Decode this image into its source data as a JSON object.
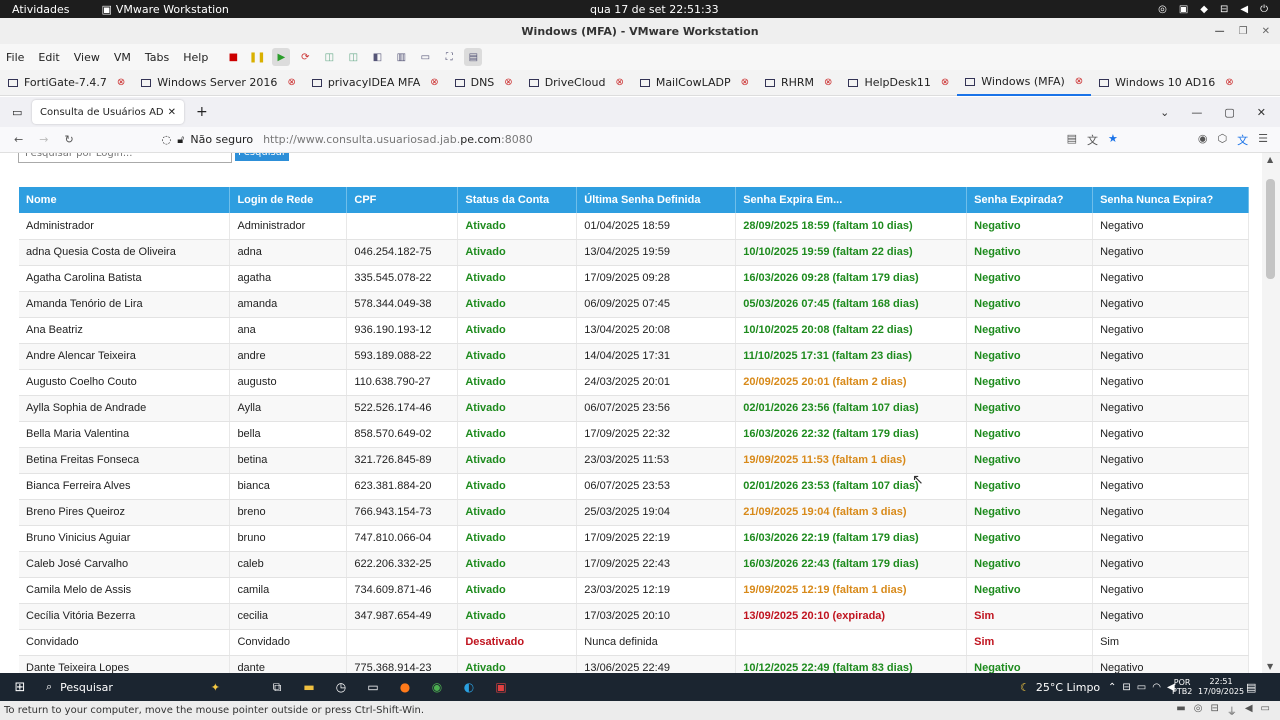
{
  "gnome": {
    "activities": "Atividades",
    "app_name": "VMware Workstation",
    "clock": "qua 17 de set  22:51:33"
  },
  "vmware": {
    "title": "Windows (MFA) - VMware Workstation",
    "menu": [
      "File",
      "Edit",
      "View",
      "VM",
      "Tabs",
      "Help"
    ],
    "tabs": [
      {
        "label": "FortiGate-7.4.7",
        "active": false
      },
      {
        "label": "Windows Server 2016",
        "active": false
      },
      {
        "label": "privacyIDEA MFA",
        "active": false
      },
      {
        "label": "DNS",
        "active": false
      },
      {
        "label": "DriveCloud",
        "active": false
      },
      {
        "label": "MailCowLADP",
        "active": false
      },
      {
        "label": "RHRM",
        "active": false
      },
      {
        "label": "HelpDesk11",
        "active": false
      },
      {
        "label": "Windows (MFA)",
        "active": true
      },
      {
        "label": "Windows 10 AD16",
        "active": false
      }
    ],
    "status_text": "To return to your computer, move the mouse pointer outside or press Ctrl-Shift-Win."
  },
  "browser": {
    "tab_title": "Consulta de Usuários AD",
    "security_label": "Não seguro",
    "url_prefix": "http://www.consulta.usuariosad.jab.",
    "url_domain": "pe.com",
    "url_suffix": ":8080"
  },
  "page": {
    "search_placeholder": "Pesquisar por Login...",
    "search_button": "Pesquisar",
    "columns": [
      "Nome",
      "Login de Rede",
      "CPF",
      "Status da Conta",
      "Última Senha Definida",
      "Senha Expira Em...",
      "Senha Expirada?",
      "Senha Nunca Expira?"
    ],
    "rows": [
      {
        "nome": "Administrador",
        "login": "Administrador",
        "cpf": "",
        "status": "Ativado",
        "status_color": "#1e8b1e",
        "ultima": "01/04/2025 18:59",
        "expira": "28/09/2025 18:59 (faltam 10 dias)",
        "expira_color": "#1e8b1e",
        "expirada": "Negativo",
        "expirada_color": "#1e8b1e",
        "nunca": "Negativo"
      },
      {
        "nome": "adna Quesia Costa de Oliveira",
        "login": "adna",
        "cpf": "046.254.182-75",
        "status": "Ativado",
        "status_color": "#1e8b1e",
        "ultima": "13/04/2025 19:59",
        "expira": "10/10/2025 19:59 (faltam 22 dias)",
        "expira_color": "#1e8b1e",
        "expirada": "Negativo",
        "expirada_color": "#1e8b1e",
        "nunca": "Negativo"
      },
      {
        "nome": "Agatha Carolina Batista",
        "login": "agatha",
        "cpf": "335.545.078-22",
        "status": "Ativado",
        "status_color": "#1e8b1e",
        "ultima": "17/09/2025 09:28",
        "expira": "16/03/2026 09:28 (faltam 179 dias)",
        "expira_color": "#1e8b1e",
        "expirada": "Negativo",
        "expirada_color": "#1e8b1e",
        "nunca": "Negativo"
      },
      {
        "nome": "Amanda Tenório de Lira",
        "login": "amanda",
        "cpf": "578.344.049-38",
        "status": "Ativado",
        "status_color": "#1e8b1e",
        "ultima": "06/09/2025 07:45",
        "expira": "05/03/2026 07:45 (faltam 168 dias)",
        "expira_color": "#1e8b1e",
        "expirada": "Negativo",
        "expirada_color": "#1e8b1e",
        "nunca": "Negativo"
      },
      {
        "nome": "Ana Beatriz",
        "login": "ana",
        "cpf": "936.190.193-12",
        "status": "Ativado",
        "status_color": "#1e8b1e",
        "ultima": "13/04/2025 20:08",
        "expira": "10/10/2025 20:08 (faltam 22 dias)",
        "expira_color": "#1e8b1e",
        "expirada": "Negativo",
        "expirada_color": "#1e8b1e",
        "nunca": "Negativo"
      },
      {
        "nome": "Andre Alencar Teixeira",
        "login": "andre",
        "cpf": "593.189.088-22",
        "status": "Ativado",
        "status_color": "#1e8b1e",
        "ultima": "14/04/2025 17:31",
        "expira": "11/10/2025 17:31 (faltam 23 dias)",
        "expira_color": "#1e8b1e",
        "expirada": "Negativo",
        "expirada_color": "#1e8b1e",
        "nunca": "Negativo"
      },
      {
        "nome": "Augusto Coelho Couto",
        "login": "augusto",
        "cpf": "110.638.790-27",
        "status": "Ativado",
        "status_color": "#1e8b1e",
        "ultima": "24/03/2025 20:01",
        "expira": "20/09/2025 20:01 (faltam 2 dias)",
        "expira_color": "#d88a1a",
        "expirada": "Negativo",
        "expirada_color": "#1e8b1e",
        "nunca": "Negativo"
      },
      {
        "nome": "Aylla Sophia de Andrade",
        "login": "Aylla",
        "cpf": "522.526.174-46",
        "status": "Ativado",
        "status_color": "#1e8b1e",
        "ultima": "06/07/2025 23:56",
        "expira": "02/01/2026 23:56 (faltam 107 dias)",
        "expira_color": "#1e8b1e",
        "expirada": "Negativo",
        "expirada_color": "#1e8b1e",
        "nunca": "Negativo"
      },
      {
        "nome": "Bella Maria Valentina",
        "login": "bella",
        "cpf": "858.570.649-02",
        "status": "Ativado",
        "status_color": "#1e8b1e",
        "ultima": "17/09/2025 22:32",
        "expira": "16/03/2026 22:32 (faltam 179 dias)",
        "expira_color": "#1e8b1e",
        "expirada": "Negativo",
        "expirada_color": "#1e8b1e",
        "nunca": "Negativo"
      },
      {
        "nome": "Betina Freitas Fonseca",
        "login": "betina",
        "cpf": "321.726.845-89",
        "status": "Ativado",
        "status_color": "#1e8b1e",
        "ultima": "23/03/2025 11:53",
        "expira": "19/09/2025 11:53 (faltam 1 dias)",
        "expira_color": "#d88a1a",
        "expirada": "Negativo",
        "expirada_color": "#1e8b1e",
        "nunca": "Negativo"
      },
      {
        "nome": "Bianca Ferreira Alves",
        "login": "bianca",
        "cpf": "623.381.884-20",
        "status": "Ativado",
        "status_color": "#1e8b1e",
        "ultima": "06/07/2025 23:53",
        "expira": "02/01/2026 23:53 (faltam 107 dias)",
        "expira_color": "#1e8b1e",
        "expirada": "Negativo",
        "expirada_color": "#1e8b1e",
        "nunca": "Negativo"
      },
      {
        "nome": "Breno Pires Queiroz",
        "login": "breno",
        "cpf": "766.943.154-73",
        "status": "Ativado",
        "status_color": "#1e8b1e",
        "ultima": "25/03/2025 19:04",
        "expira": "21/09/2025 19:04 (faltam 3 dias)",
        "expira_color": "#d88a1a",
        "expirada": "Negativo",
        "expirada_color": "#1e8b1e",
        "nunca": "Negativo"
      },
      {
        "nome": "Bruno Vinicius Aguiar",
        "login": "bruno",
        "cpf": "747.810.066-04",
        "status": "Ativado",
        "status_color": "#1e8b1e",
        "ultima": "17/09/2025 22:19",
        "expira": "16/03/2026 22:19 (faltam 179 dias)",
        "expira_color": "#1e8b1e",
        "expirada": "Negativo",
        "expirada_color": "#1e8b1e",
        "nunca": "Negativo"
      },
      {
        "nome": "Caleb José Carvalho",
        "login": "caleb",
        "cpf": "622.206.332-25",
        "status": "Ativado",
        "status_color": "#1e8b1e",
        "ultima": "17/09/2025 22:43",
        "expira": "16/03/2026 22:43 (faltam 179 dias)",
        "expira_color": "#1e8b1e",
        "expirada": "Negativo",
        "expirada_color": "#1e8b1e",
        "nunca": "Negativo"
      },
      {
        "nome": "Camila Melo de Assis",
        "login": "camila",
        "cpf": "734.609.871-46",
        "status": "Ativado",
        "status_color": "#1e8b1e",
        "ultima": "23/03/2025 12:19",
        "expira": "19/09/2025 12:19 (faltam 1 dias)",
        "expira_color": "#d88a1a",
        "expirada": "Negativo",
        "expirada_color": "#1e8b1e",
        "nunca": "Negativo"
      },
      {
        "nome": "Cecília Vitória Bezerra",
        "login": "cecilia",
        "cpf": "347.987.654-49",
        "status": "Ativado",
        "status_color": "#1e8b1e",
        "ultima": "17/03/2025 20:10",
        "expira": "13/09/2025 20:10 (expirada)",
        "expira_color": "#c0141f",
        "expirada": "Sim",
        "expirada_color": "#c0141f",
        "nunca": "Negativo"
      },
      {
        "nome": "Convidado",
        "login": "Convidado",
        "cpf": "",
        "status": "Desativado",
        "status_color": "#c0141f",
        "ultima": "Nunca definida",
        "expira": "",
        "expira_color": "#1e8b1e",
        "expirada": "Sim",
        "expirada_color": "#c0141f",
        "nunca": "Sim"
      },
      {
        "nome": "Dante Teixeira Lopes",
        "login": "dante",
        "cpf": "775.368.914-23",
        "status": "Ativado",
        "status_color": "#1e8b1e",
        "ultima": "13/06/2025 22:49",
        "expira": "10/12/2025 22:49 (faltam 83 dias)",
        "expira_color": "#1e8b1e",
        "expirada": "Negativo",
        "expirada_color": "#1e8b1e",
        "nunca": "Negativo"
      }
    ]
  },
  "taskbar": {
    "search_label": "Pesquisar",
    "weather": "25°C  Limpo",
    "lang_line1": "POR",
    "lang_line2": "PTB2",
    "time": "22:51",
    "date": "17/09/2025"
  }
}
